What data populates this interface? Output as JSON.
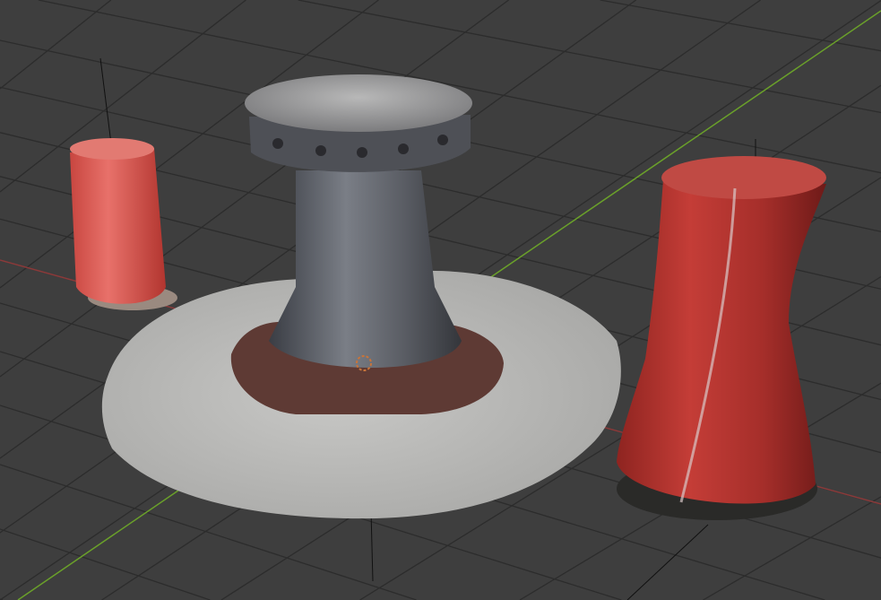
{
  "viewport": {
    "background": "#3e3e3e",
    "grid_color": "#2c2c2c",
    "x_axis_color": "#8a3a3a",
    "y_axis_color": "#6aa02a"
  },
  "scene": {
    "objects": [
      {
        "name": "small-bollard",
        "color": "#d8554f"
      },
      {
        "name": "capstan",
        "color": "#5c5f66"
      },
      {
        "name": "concrete-base",
        "color": "#bdbdbb"
      },
      {
        "name": "large-bollard",
        "color": "#b8302c"
      }
    ]
  }
}
